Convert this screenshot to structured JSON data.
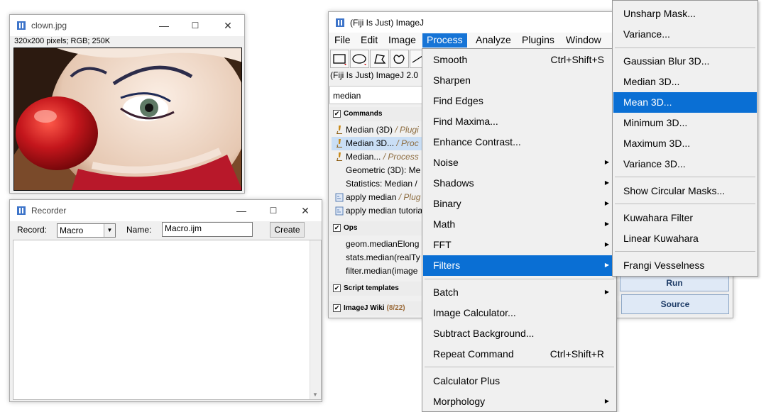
{
  "clown_window": {
    "title": "clown.jpg",
    "info": "320x200 pixels; RGB; 250K"
  },
  "recorder_window": {
    "title": "Recorder",
    "record_label": "Record:",
    "record_value": "Macro",
    "name_label": "Name:",
    "name_value": "Macro.ijm",
    "create_label": "Create"
  },
  "imagej_window": {
    "title": "(Fiji Is Just) ImageJ",
    "menus": [
      "File",
      "Edit",
      "Image",
      "Process",
      "Analyze",
      "Plugins",
      "Window"
    ],
    "active_menu": "Process",
    "status": "(Fiji Is Just) ImageJ 2.0",
    "search_value": "median",
    "sections": {
      "commands": "Commands",
      "ops": "Ops",
      "script_templates": "Script templates",
      "wiki": "ImageJ Wiki",
      "wiki_count": "(8/22)"
    },
    "commands": [
      {
        "name": "Median (3D)",
        "src": " / Plugi"
      },
      {
        "name": "Median 3D...",
        "src": " / Proc"
      },
      {
        "name": "Median...",
        "src": " / Process"
      },
      {
        "name": "Geometric (3D): Me",
        "src": ""
      },
      {
        "name": "Statistics: Median  /",
        "src": ""
      },
      {
        "name": "apply median",
        "src": " / Plug"
      },
      {
        "name": "apply median tutoria",
        "src": ""
      }
    ],
    "ops": [
      "geom.medianElong",
      "stats.median(realTy",
      "filter.median(image"
    ],
    "run_label": "Run",
    "source_label": "Source"
  },
  "process_menu": {
    "items": [
      {
        "label": "Smooth",
        "shortcut": "Ctrl+Shift+S"
      },
      {
        "label": "Sharpen"
      },
      {
        "label": "Find Edges"
      },
      {
        "label": "Find Maxima..."
      },
      {
        "label": "Enhance Contrast..."
      },
      {
        "label": "Noise",
        "submenu": true
      },
      {
        "label": "Shadows",
        "submenu": true
      },
      {
        "label": "Binary",
        "submenu": true
      },
      {
        "label": "Math",
        "submenu": true
      },
      {
        "label": "FFT",
        "submenu": true
      },
      {
        "label": "Filters",
        "submenu": true,
        "highlighted": true
      },
      {
        "label": "Batch",
        "submenu": true
      },
      {
        "label": "Image Calculator..."
      },
      {
        "label": "Subtract Background..."
      },
      {
        "label": "Repeat Command",
        "shortcut": "Ctrl+Shift+R"
      },
      {
        "label": "Calculator Plus"
      },
      {
        "label": "Morphology",
        "submenu": true
      }
    ]
  },
  "filters_menu": {
    "items": [
      {
        "label": "Unsharp Mask..."
      },
      {
        "label": "Variance..."
      },
      {
        "label": "Gaussian Blur 3D..."
      },
      {
        "label": "Median 3D..."
      },
      {
        "label": "Mean 3D...",
        "highlighted": true
      },
      {
        "label": "Minimum 3D..."
      },
      {
        "label": "Maximum 3D..."
      },
      {
        "label": "Variance 3D..."
      },
      {
        "label": "Show Circular Masks..."
      },
      {
        "label": "Kuwahara Filter"
      },
      {
        "label": "Linear Kuwahara"
      },
      {
        "label": "Frangi Vesselness"
      }
    ]
  },
  "colors": {
    "menu_highlight": "#0a6fd4",
    "selection": "#c9def5"
  }
}
